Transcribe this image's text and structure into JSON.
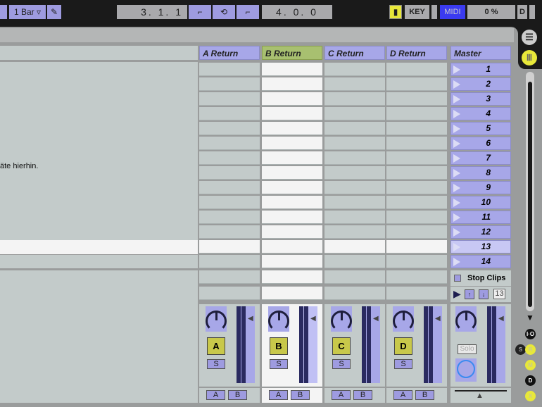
{
  "toolbar": {
    "quantize": "1 Bar",
    "position": "3. 1. 1",
    "loop_length": "4. 0. 0",
    "key": "KEY",
    "midi": "MIDI",
    "cpu": "0 %",
    "d": "D"
  },
  "session": {
    "drop_hint": "äte hierhin.",
    "returns": [
      {
        "name": "A Return",
        "letter": "A"
      },
      {
        "name": "B Return",
        "letter": "B"
      },
      {
        "name": "C Return",
        "letter": "C"
      },
      {
        "name": "D Return",
        "letter": "D"
      }
    ],
    "master": {
      "name": "Master",
      "scenes": [
        "1",
        "2",
        "3",
        "4",
        "5",
        "6",
        "7",
        "8",
        "9",
        "10",
        "11",
        "12",
        "13",
        "14"
      ],
      "stop_clips": "Stop Clips",
      "scene_number": "13",
      "solo": "Solo"
    },
    "solo_label": "S",
    "sends": [
      "A",
      "B"
    ]
  },
  "sidebar": {
    "io": "I·O",
    "s": "S",
    "r": "R",
    "m": "M",
    "d": "D",
    "x": "X"
  },
  "colors": {
    "accent": "#a7a7e8",
    "selected": "#c8c84a"
  }
}
